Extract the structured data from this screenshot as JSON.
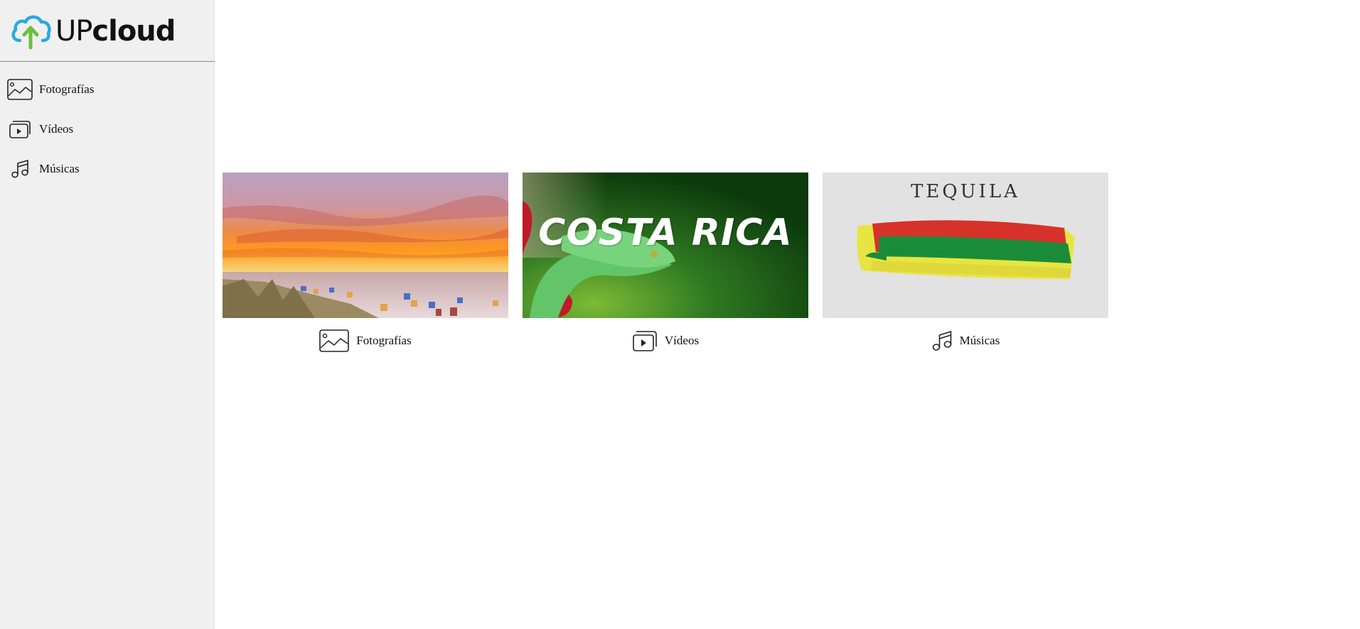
{
  "app": {
    "logo_text_light": "UP",
    "logo_text_bold": "cloud",
    "brand_colors": {
      "cloud": "#2aa8e0",
      "arrow": "#6cbf3b"
    }
  },
  "sidebar": {
    "items": [
      {
        "label": "Fotografías",
        "icon": "image-icon"
      },
      {
        "label": "Vídeos",
        "icon": "video-icon"
      },
      {
        "label": "Músicas",
        "icon": "music-icon"
      }
    ]
  },
  "main": {
    "cards": [
      {
        "label": "Fotografías",
        "icon": "image-icon",
        "thumbnail": "sunset beach"
      },
      {
        "label": "Vídeos",
        "icon": "video-icon",
        "thumbnail_text": "COSTA RICA"
      },
      {
        "label": "Músicas",
        "icon": "music-icon",
        "thumbnail_text": "TEQUILA"
      }
    ]
  }
}
